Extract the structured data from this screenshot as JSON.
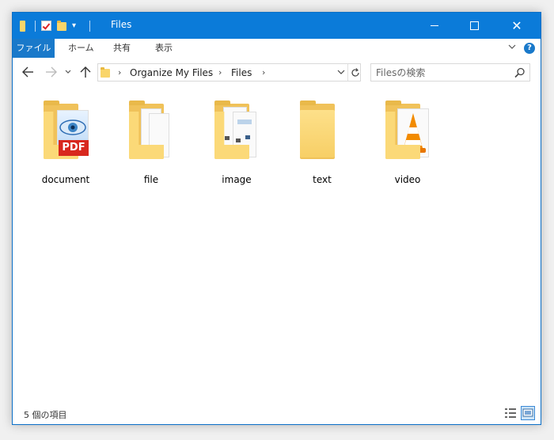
{
  "window": {
    "title": "Files"
  },
  "ribbon": {
    "tabs": [
      {
        "label": "ファイル",
        "active": true
      },
      {
        "label": "ホーム"
      },
      {
        "label": "共有"
      },
      {
        "label": "表示"
      }
    ],
    "help_label": "?"
  },
  "navigation": {
    "breadcrumb": [
      "Organize My Files",
      "Files"
    ],
    "search_placeholder": "Filesの検索"
  },
  "content": {
    "items": [
      {
        "name": "document",
        "overlay": "PDF"
      },
      {
        "name": "file"
      },
      {
        "name": "image"
      },
      {
        "name": "text"
      },
      {
        "name": "video"
      }
    ]
  },
  "status": {
    "item_count": "5 個の項目"
  },
  "colors": {
    "titlebar": "#0b7bd9",
    "file_tab": "#1979ca",
    "folder": "#fbd978"
  }
}
